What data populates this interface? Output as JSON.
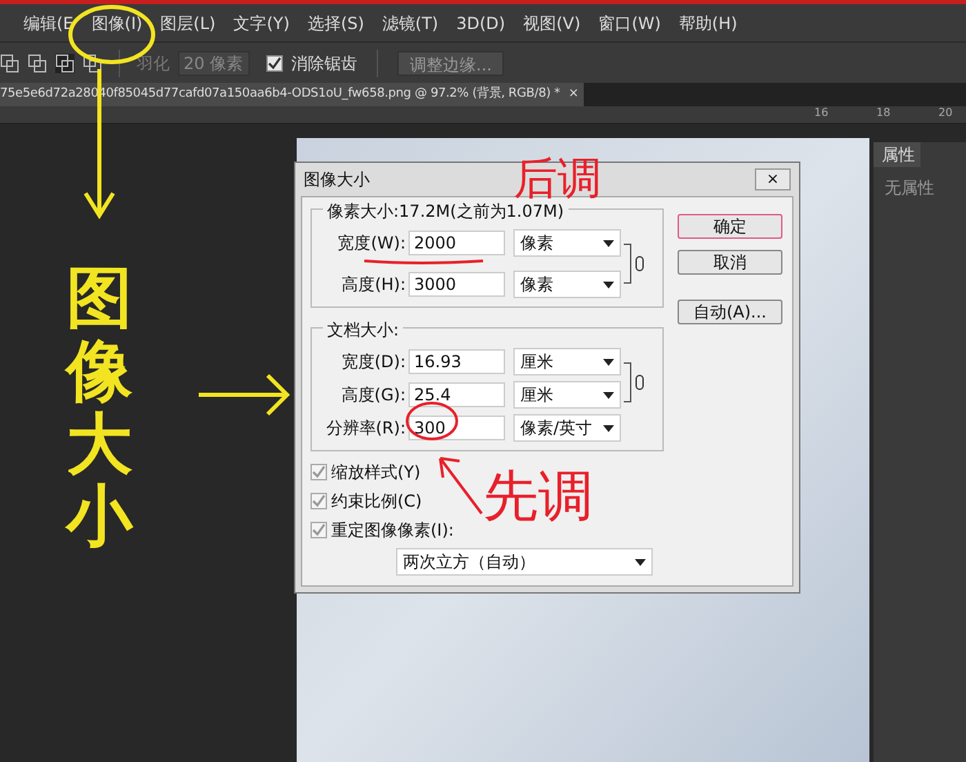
{
  "menu": [
    {
      "label": "编辑(E"
    },
    {
      "label": "图像(I)"
    },
    {
      "label": "图层(L)"
    },
    {
      "label": "文字(Y)"
    },
    {
      "label": "选择(S)"
    },
    {
      "label": "滤镜(T)"
    },
    {
      "label": "3D(D)"
    },
    {
      "label": "视图(V)"
    },
    {
      "label": "窗口(W)"
    },
    {
      "label": "帮助(H)"
    }
  ],
  "options_bar": {
    "feather_label": "羽化",
    "feather_disabled": true,
    "feather_value": "20 像素",
    "antialias": {
      "label": "消除锯齿",
      "checked": true
    },
    "refine_button": "调整边缘..."
  },
  "document_tab": {
    "title": "75e5e6d72a28040f85045d77cafd07a150aa6b4-ODS1oU_fw658.png @ 97.2% (背景, RGB/8) *",
    "close": "×"
  },
  "ruler": {
    "labels": [
      "16",
      "18",
      "20"
    ]
  },
  "properties_panel": {
    "tab": "属性",
    "text": "无属性"
  },
  "dialog": {
    "title": "图像大小",
    "close": "×",
    "pixel_group": {
      "title": "像素大小:17.2M(之前为1.07M)",
      "rows": [
        {
          "label": "宽度(W):",
          "value": "2000",
          "unit": "像素"
        },
        {
          "label": "高度(H):",
          "value": "3000",
          "unit": "像素"
        }
      ]
    },
    "document_group": {
      "title": "文档大小:",
      "rows": [
        {
          "label": "宽度(D):",
          "value": "16.93",
          "unit": "厘米"
        },
        {
          "label": "高度(G):",
          "value": "25.4",
          "unit": "厘米"
        },
        {
          "label": "分辨率(R):",
          "value": "300",
          "unit": "像素/英寸"
        }
      ]
    },
    "checkboxes": [
      {
        "label": "缩放样式(Y)",
        "checked": true
      },
      {
        "label": "约束比例(C)",
        "checked": true
      },
      {
        "label": "重定图像像素(I):",
        "checked": true
      }
    ],
    "resample": "两次立方（自动）",
    "buttons": [
      {
        "label": "确定",
        "default": true
      },
      {
        "label": "取消",
        "default": false
      },
      {
        "label": "自动(A)...",
        "default": false
      }
    ]
  },
  "annotations": {
    "vertical_note": {
      "text": "图像大小",
      "color": "#f2e421"
    },
    "top_note": {
      "text": "后调",
      "color": "#e8202a"
    },
    "bottom_note": {
      "text": "先调",
      "color": "#e8202a"
    }
  }
}
